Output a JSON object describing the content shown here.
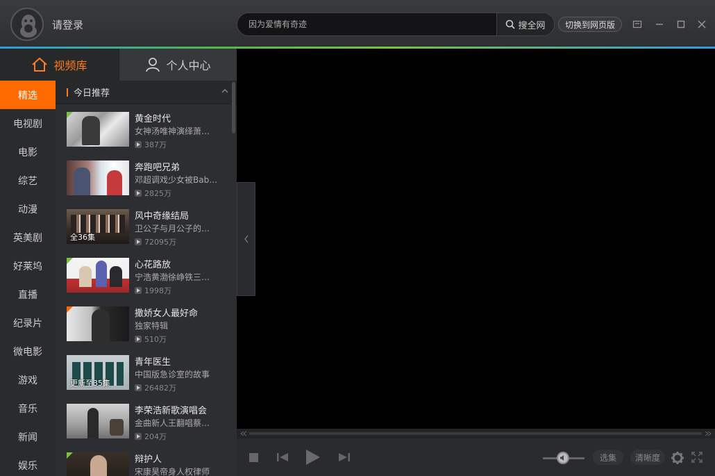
{
  "header": {
    "login_label": "请登录",
    "search_placeholder": "因为爱情有奇迹",
    "search_button": "搜全网",
    "switch_button": "切换到网页版"
  },
  "tabs": [
    {
      "label": "视频库",
      "active": true
    },
    {
      "label": "个人中心",
      "active": false
    }
  ],
  "categories": [
    "精选",
    "电视剧",
    "电影",
    "综艺",
    "动漫",
    "英美剧",
    "好莱坞",
    "直播",
    "纪录片",
    "微电影",
    "游戏",
    "音乐",
    "新闻",
    "娱乐"
  ],
  "active_category": "精选",
  "list": {
    "header": "今日推荐",
    "items": [
      {
        "title": "黄金时代",
        "desc": "女神汤唯神演绎萧…",
        "plays": "387万",
        "badge": "green",
        "ep": ""
      },
      {
        "title": "奔跑吧兄弟",
        "desc": "邓超调戏少女被Bab…",
        "plays": "2825万",
        "badge": "",
        "ep": ""
      },
      {
        "title": "风中奇缘结局",
        "desc": "卫公子与月公子的…",
        "plays": "72095万",
        "badge": "",
        "ep": "全36集"
      },
      {
        "title": "心花路放",
        "desc": "宁浩黄渤徐峥铁三…",
        "plays": "1998万",
        "badge": "green",
        "ep": ""
      },
      {
        "title": "撒娇女人最好命",
        "desc": "独家特辑",
        "plays": "510万",
        "badge": "orange",
        "ep": ""
      },
      {
        "title": "青年医生",
        "desc": "中国版急诊室的故事",
        "plays": "26482万",
        "badge": "",
        "ep": "更新至35集"
      },
      {
        "title": "李荣浩新歌演唱会",
        "desc": "金曲新人王翻唱蔡…",
        "plays": "204万",
        "badge": "",
        "ep": ""
      },
      {
        "title": "辩护人",
        "desc": "宋康昊帝身人权律师",
        "plays": "",
        "badge": "green",
        "ep": ""
      }
    ]
  },
  "player": {
    "episodes_button": "选集",
    "quality_button": "清晰度"
  },
  "colors": {
    "accent": "#ff6a00",
    "green_badge": "#7bc043"
  }
}
